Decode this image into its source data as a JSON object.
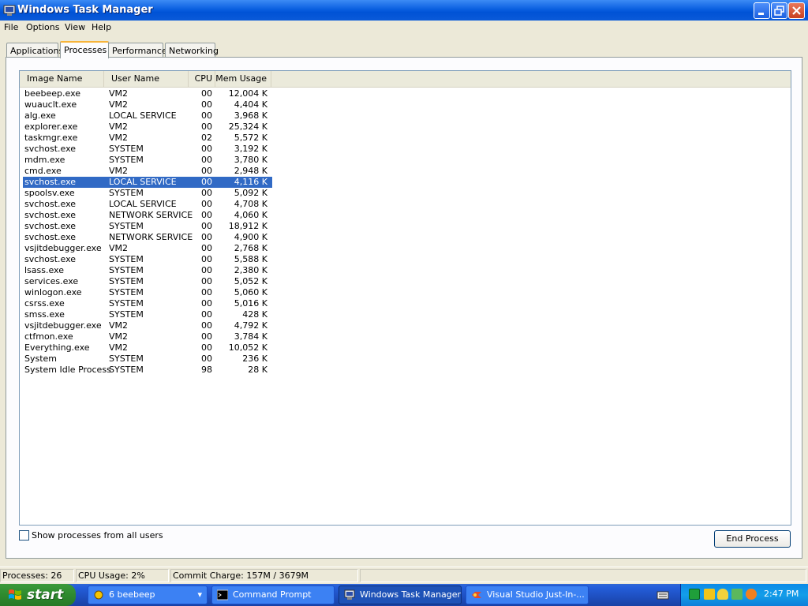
{
  "window": {
    "title": "Windows Task Manager"
  },
  "menu": [
    "File",
    "Options",
    "View",
    "Help"
  ],
  "tabs": [
    "Applications",
    "Processes",
    "Performance",
    "Networking"
  ],
  "columns": [
    "Image Name",
    "User Name",
    "CPU",
    "Mem Usage"
  ],
  "processes": [
    {
      "name": "beebeep.exe",
      "user": "VM2",
      "cpu": "00",
      "mem": "12,004 K"
    },
    {
      "name": "wuauclt.exe",
      "user": "VM2",
      "cpu": "00",
      "mem": "4,404 K"
    },
    {
      "name": "alg.exe",
      "user": "LOCAL SERVICE",
      "cpu": "00",
      "mem": "3,968 K"
    },
    {
      "name": "explorer.exe",
      "user": "VM2",
      "cpu": "00",
      "mem": "25,324 K"
    },
    {
      "name": "taskmgr.exe",
      "user": "VM2",
      "cpu": "02",
      "mem": "5,572 K"
    },
    {
      "name": "svchost.exe",
      "user": "SYSTEM",
      "cpu": "00",
      "mem": "3,192 K"
    },
    {
      "name": "mdm.exe",
      "user": "SYSTEM",
      "cpu": "00",
      "mem": "3,780 K"
    },
    {
      "name": "cmd.exe",
      "user": "VM2",
      "cpu": "00",
      "mem": "2,948 K"
    },
    {
      "name": "svchost.exe",
      "user": "LOCAL SERVICE",
      "cpu": "00",
      "mem": "4,116 K"
    },
    {
      "name": "spoolsv.exe",
      "user": "SYSTEM",
      "cpu": "00",
      "mem": "5,092 K"
    },
    {
      "name": "svchost.exe",
      "user": "LOCAL SERVICE",
      "cpu": "00",
      "mem": "4,708 K"
    },
    {
      "name": "svchost.exe",
      "user": "NETWORK SERVICE",
      "cpu": "00",
      "mem": "4,060 K"
    },
    {
      "name": "svchost.exe",
      "user": "SYSTEM",
      "cpu": "00",
      "mem": "18,912 K"
    },
    {
      "name": "svchost.exe",
      "user": "NETWORK SERVICE",
      "cpu": "00",
      "mem": "4,900 K"
    },
    {
      "name": "vsjitdebugger.exe",
      "user": "VM2",
      "cpu": "00",
      "mem": "2,768 K"
    },
    {
      "name": "svchost.exe",
      "user": "SYSTEM",
      "cpu": "00",
      "mem": "5,588 K"
    },
    {
      "name": "lsass.exe",
      "user": "SYSTEM",
      "cpu": "00",
      "mem": "2,380 K"
    },
    {
      "name": "services.exe",
      "user": "SYSTEM",
      "cpu": "00",
      "mem": "5,052 K"
    },
    {
      "name": "winlogon.exe",
      "user": "SYSTEM",
      "cpu": "00",
      "mem": "5,060 K"
    },
    {
      "name": "csrss.exe",
      "user": "SYSTEM",
      "cpu": "00",
      "mem": "5,016 K"
    },
    {
      "name": "smss.exe",
      "user": "SYSTEM",
      "cpu": "00",
      "mem": "428 K"
    },
    {
      "name": "vsjitdebugger.exe",
      "user": "VM2",
      "cpu": "00",
      "mem": "4,792 K"
    },
    {
      "name": "ctfmon.exe",
      "user": "VM2",
      "cpu": "00",
      "mem": "3,784 K"
    },
    {
      "name": "Everything.exe",
      "user": "VM2",
      "cpu": "00",
      "mem": "10,052 K"
    },
    {
      "name": "System",
      "user": "SYSTEM",
      "cpu": "00",
      "mem": "236 K"
    },
    {
      "name": "System Idle Process",
      "user": "SYSTEM",
      "cpu": "98",
      "mem": "28 K"
    }
  ],
  "selected_row": 8,
  "show_all_label": "Show processes from all users",
  "show_all_checked": false,
  "end_process_label": "End Process",
  "status": {
    "processes": "Processes: 26",
    "cpu": "CPU Usage: 2%",
    "commit": "Commit Charge: 157M / 3679M"
  },
  "taskbar": {
    "start_label": "start",
    "buttons": [
      "6 beebeep",
      "Command Prompt",
      "Windows Task Manager",
      "Visual Studio Just-In-..."
    ],
    "active_button": 2,
    "clock": "2:47 PM"
  },
  "colors": {
    "selection": "#316ac5",
    "titlebar": "#0a5fe0",
    "taskbar": "#245edb",
    "start": "#2e8a2e",
    "tray": "#139ee9"
  }
}
